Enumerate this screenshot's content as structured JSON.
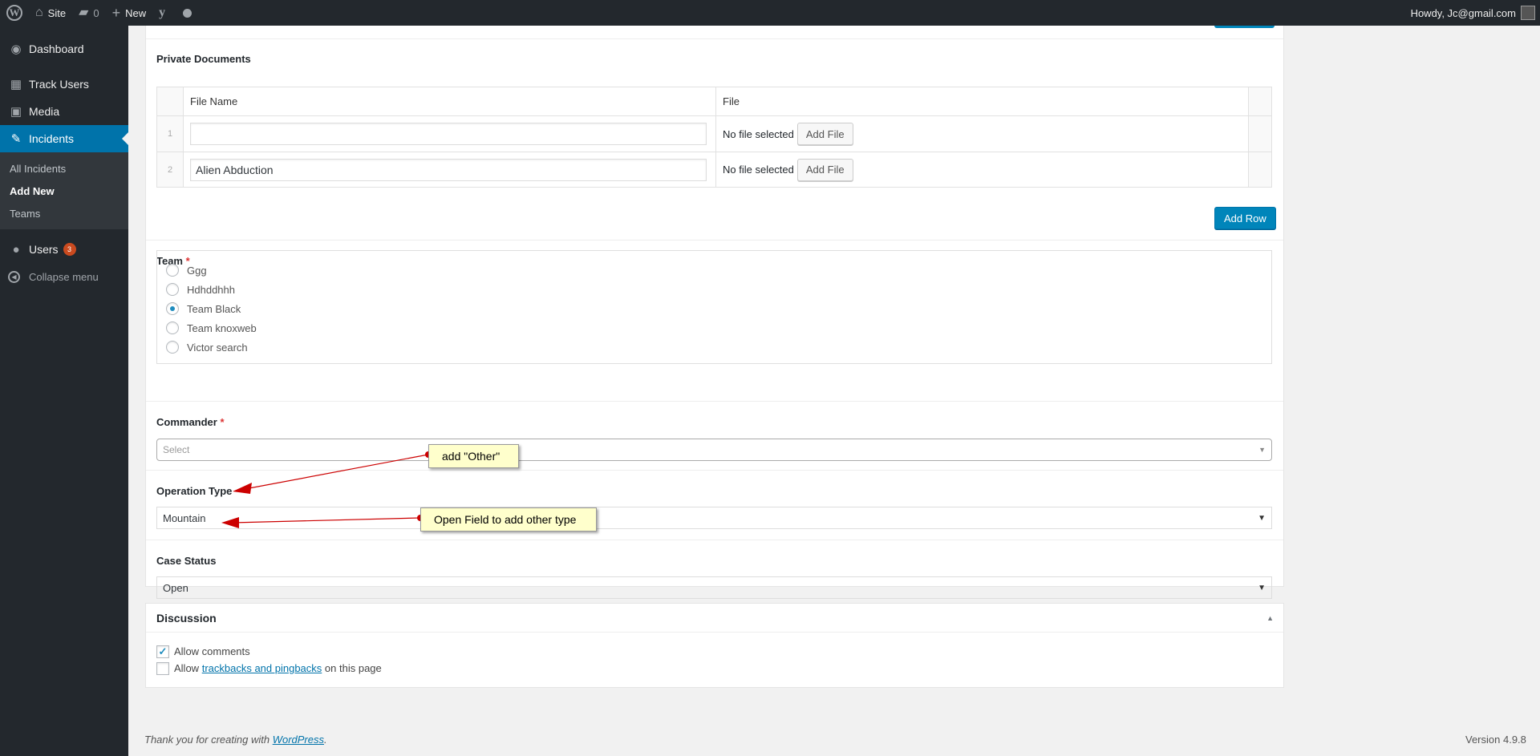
{
  "adminbar": {
    "site": "Site",
    "comments_count": "0",
    "new_label": "New",
    "howdy": "Howdy, Jc@gmail.com"
  },
  "sidebar": {
    "items": [
      {
        "label": "Dashboard",
        "icon": "dashboard-icon"
      },
      {
        "label": "Track Users",
        "icon": "table-icon"
      },
      {
        "label": "Media",
        "icon": "media-icon"
      },
      {
        "label": "Incidents",
        "icon": "pin-icon"
      }
    ],
    "submenu": [
      "All Incidents",
      "Add New",
      "Teams"
    ],
    "users": {
      "label": "Users",
      "badge": "3"
    },
    "collapse": "Collapse menu"
  },
  "private_documents": {
    "label": "Private Documents",
    "columns": [
      "File Name",
      "File"
    ],
    "rows": [
      {
        "order": "1",
        "file_name": "",
        "file_status": "No file selected",
        "button": "Add File"
      },
      {
        "order": "2",
        "file_name": "Alien Abduction",
        "file_status": "No file selected",
        "button": "Add File"
      }
    ],
    "add_row": "Add Row"
  },
  "team": {
    "label": "Team",
    "required": "*",
    "options": [
      "Ggg",
      "Hdhddhhh",
      "Team Black",
      "Team knoxweb",
      "Victor search"
    ],
    "selected": "Team Black"
  },
  "commander": {
    "label": "Commander",
    "required": "*",
    "placeholder": "Select"
  },
  "operation_type": {
    "label": "Operation Type",
    "value": "Mountain"
  },
  "case_status": {
    "label": "Case Status",
    "value": "Open"
  },
  "discussion": {
    "title": "Discussion",
    "allow_comments": "Allow comments",
    "allow_prefix": "Allow",
    "trackbacks_link": "trackbacks and pingbacks",
    "allow_suffix": "on this page",
    "comments_checked": true,
    "trackbacks_checked": false
  },
  "footer": {
    "thanks_prefix": "Thank you for creating with",
    "wordpress_link": "WordPress",
    "thanks_suffix": ".",
    "version": "Version 4.9.8"
  },
  "annotations": {
    "note1": "add \"Other\"",
    "note2": "Open Field to add other type",
    "arrow_color": "#cc0000"
  },
  "colors": {
    "primary": "#0073aa",
    "adminbar": "#23282d",
    "required": "#dc3232",
    "badge": "#ca4a1f"
  }
}
